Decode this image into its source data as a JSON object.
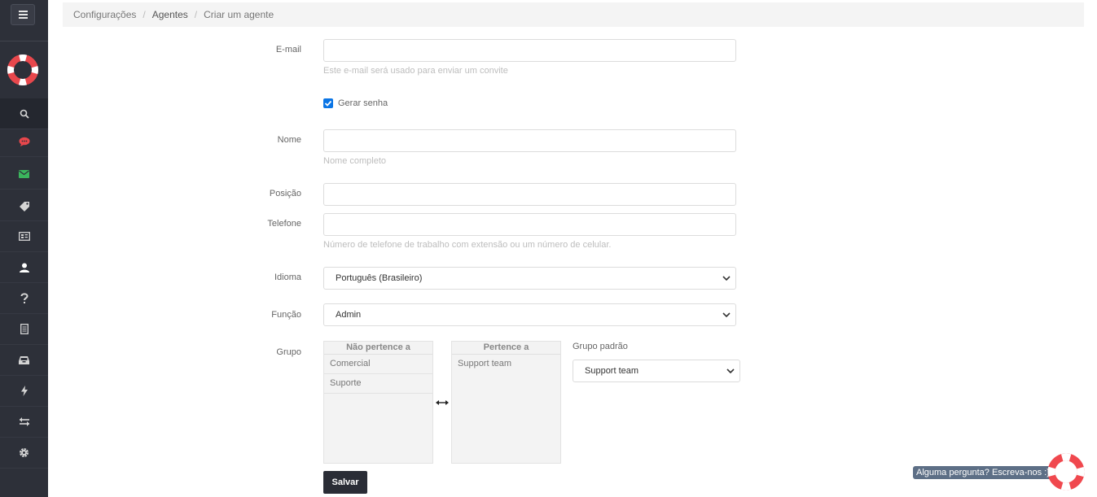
{
  "breadcrumb": {
    "items": [
      "Configurações",
      "Agentes",
      "Criar um agente"
    ],
    "separator": "/"
  },
  "form": {
    "email": {
      "label": "E-mail",
      "value": "",
      "hint": "Este e-mail será usado para enviar um convite"
    },
    "generate_password": {
      "label": "Gerar senha",
      "checked": true
    },
    "name": {
      "label": "Nome",
      "value": "",
      "hint": "Nome completo"
    },
    "position": {
      "label": "Posição",
      "value": ""
    },
    "phone": {
      "label": "Telefone",
      "value": "",
      "hint": "Número de telefone de trabalho com extensão ou um número de celular."
    },
    "language": {
      "label": "Idioma",
      "value": "Português (Brasileiro)"
    },
    "role": {
      "label": "Função",
      "value": "Admin"
    },
    "group": {
      "label": "Grupo",
      "not_belongs": {
        "header": "Não pertence a",
        "items": [
          "Comercial",
          "Suporte"
        ]
      },
      "belongs": {
        "header": "Pertence a",
        "items": [
          "Support team"
        ]
      },
      "default_group": {
        "label": "Grupo padrão",
        "value": "Support team"
      }
    },
    "save_label": "Salvar"
  },
  "sidebar": {
    "items": [
      {
        "icon": "search-icon",
        "color": "#d5d5d5"
      },
      {
        "icon": "chat-icon",
        "color": "#e8474c"
      },
      {
        "icon": "mail-icon",
        "color": "#3bb55d"
      },
      {
        "icon": "tag-icon",
        "color": "#d5d5d5"
      },
      {
        "icon": "card-icon",
        "color": "#d5d5d5"
      },
      {
        "icon": "user-icon",
        "color": "#ffffff"
      },
      {
        "icon": "help-icon",
        "color": "#d5d5d5"
      },
      {
        "icon": "document-icon",
        "color": "#d5d5d5"
      },
      {
        "icon": "inbox-icon",
        "color": "#d5d5d5"
      },
      {
        "icon": "bolt-icon",
        "color": "#d5d5d5"
      },
      {
        "icon": "transfer-icon",
        "color": "#d5d5d5"
      },
      {
        "icon": "gear-icon",
        "color": "#d5d5d5"
      }
    ]
  },
  "chat_widget": {
    "text": "Alguma pergunta? Escreva-nos :)"
  },
  "colors": {
    "sidebar_bg": "#2d3039",
    "primary": "#2a2d36",
    "checkbox": "#0b75e5",
    "brand_red": "#e8474c"
  }
}
